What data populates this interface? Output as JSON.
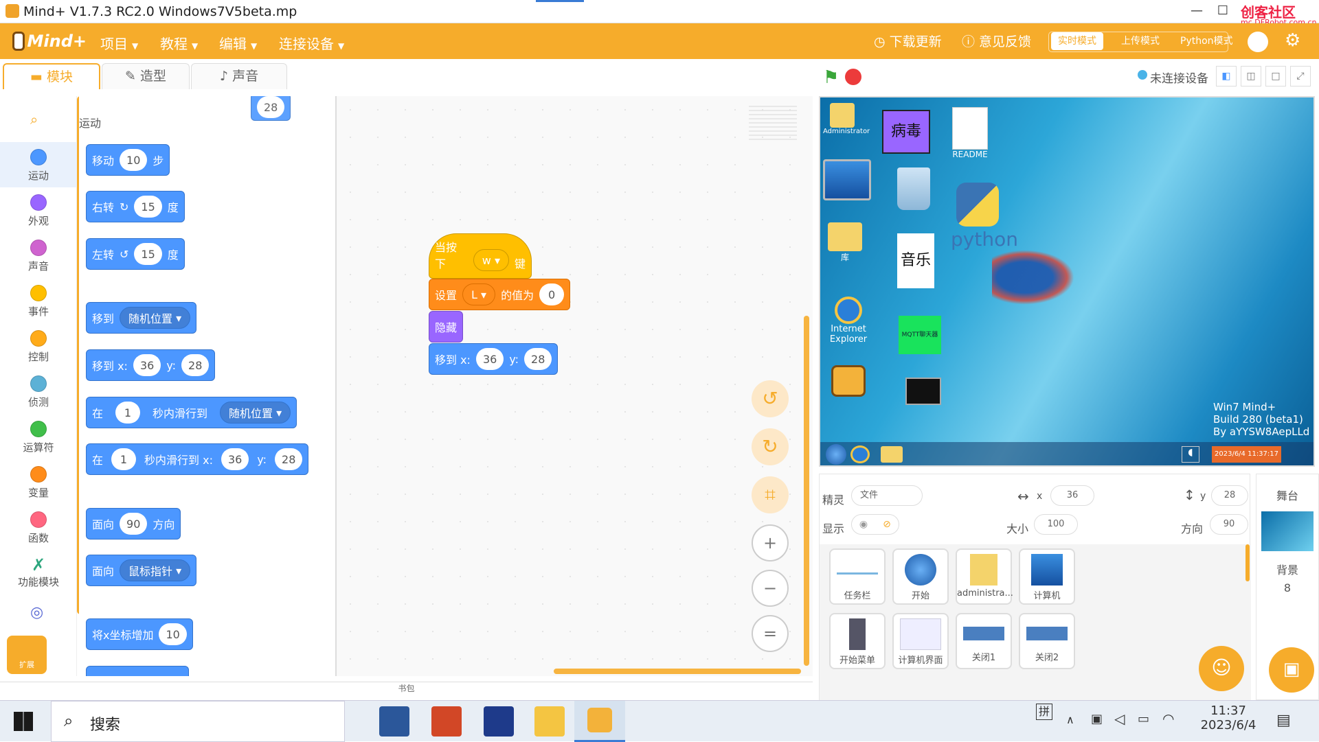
{
  "window": {
    "title": "Mind+ V1.7.3 RC2.0   Windows7V5beta.mp",
    "watermark": "创客社区",
    "watermark_url": "mc.DFRobot.com.cn",
    "minimize": "—",
    "restore": "☐"
  },
  "menubar": {
    "logo": "Mind+",
    "items": [
      "项目",
      "教程",
      "编辑",
      "连接设备"
    ],
    "download_update": "下载更新",
    "feedback": "意见反馈",
    "modes": [
      "实时模式",
      "上传模式",
      "Python模式"
    ]
  },
  "tabs": [
    "模块",
    "造型",
    "声音"
  ],
  "categories": [
    {
      "label": "运动",
      "color": "#4c97ff"
    },
    {
      "label": "外观",
      "color": "#9966ff"
    },
    {
      "label": "声音",
      "color": "#cf63cf"
    },
    {
      "label": "事件",
      "color": "#ffbf00"
    },
    {
      "label": "控制",
      "color": "#ffab19"
    },
    {
      "label": "侦测",
      "color": "#5cb1d6"
    },
    {
      "label": "运算符",
      "color": "#40bf4a"
    },
    {
      "label": "变量",
      "color": "#ff8c1a"
    },
    {
      "label": "函数",
      "color": "#ff6680"
    },
    {
      "label": "功能模块",
      "color": "#2da67e"
    }
  ],
  "extensions_label": "扩展",
  "palette": {
    "section": "运动",
    "top_partial_y": "28",
    "move": {
      "a": "移动",
      "v": "10",
      "b": "步"
    },
    "turn_right": {
      "a": "右转",
      "v": "15",
      "b": "度"
    },
    "turn_left": {
      "a": "左转",
      "v": "15",
      "b": "度"
    },
    "goto_random": {
      "a": "移到",
      "dd": "随机位置"
    },
    "goto_xy": {
      "a": "移到 x:",
      "x": "36",
      "b": "y:",
      "y": "28"
    },
    "glide_random": {
      "a": "在",
      "v": "1",
      "b": "秒内滑行到",
      "dd": "随机位置"
    },
    "glide_xy": {
      "a": "在",
      "v": "1",
      "b": "秒内滑行到 x:",
      "x": "36",
      "c": "y:",
      "y": "28"
    },
    "point_dir": {
      "a": "面向",
      "v": "90",
      "b": "方向"
    },
    "point_towards": {
      "a": "面向",
      "dd": "鼠标指针"
    },
    "change_x": {
      "a": "将x坐标增加",
      "v": "10"
    }
  },
  "script": {
    "when_key": {
      "a": "当按下",
      "key": "w",
      "b": "键"
    },
    "set_var": {
      "a": "设置",
      "var": "L",
      "b": "的值为",
      "v": "0"
    },
    "hide": "隐藏",
    "goto": {
      "a": "移到 x:",
      "x": "36",
      "b": "y:",
      "y": "28"
    }
  },
  "backpack": "书包",
  "stage_header": {
    "status": "未连接设备"
  },
  "stage": {
    "icons": [
      "Administrator",
      "库",
      "Internet Explorer",
      "README",
      "音乐",
      "MQTT聊天器"
    ],
    "virus_label": "病毒",
    "python_label": "python",
    "os_text": [
      "Win7 Mind+",
      "Build 280 (beta1)",
      "By  aYYSW8AepLLd"
    ],
    "clock": "2023/6/4 11:37:17"
  },
  "sprite_info": {
    "sprite_label": "精灵",
    "sprite_name": "文件",
    "x_label": "x",
    "x": "36",
    "y_label": "y",
    "y": "28",
    "show_label": "显示",
    "size_label": "大小",
    "size": "100",
    "dir_label": "方向",
    "direction": "90"
  },
  "sprites": [
    "任务栏",
    "开始",
    "administra...",
    "计算机",
    "开始菜单",
    "计算机界面",
    "关闭1",
    "关闭2"
  ],
  "stage_panel": {
    "title": "舞台",
    "backdrop_label": "背景",
    "backdrop_count": "8"
  },
  "taskbar": {
    "search": "搜索",
    "ime": "拼",
    "time": "11:37",
    "date": "2023/6/4"
  }
}
